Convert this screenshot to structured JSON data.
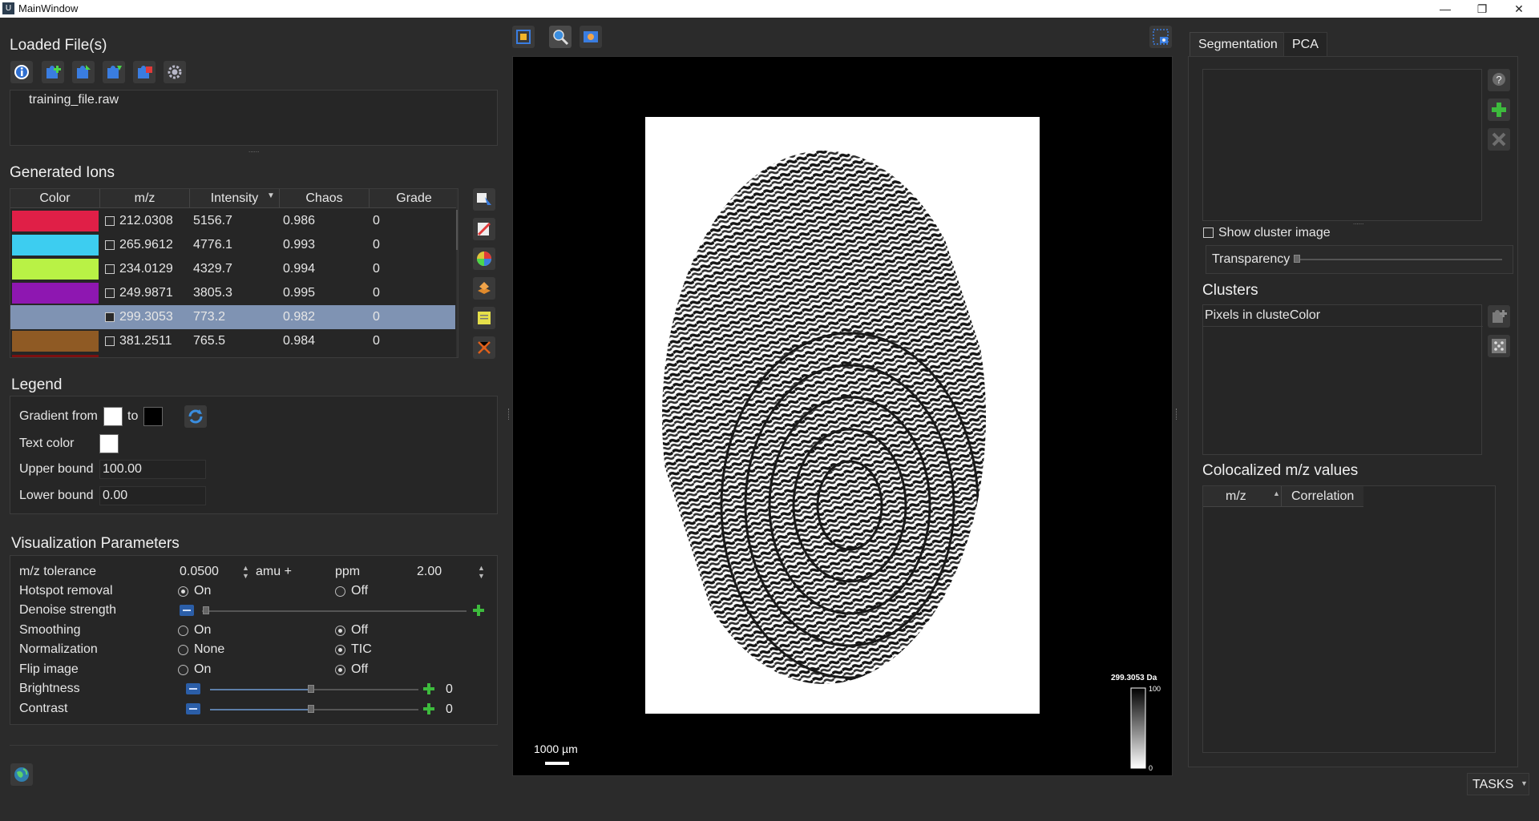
{
  "window": {
    "title": "MainWindow",
    "min": "—",
    "max": "❐",
    "close": "✕"
  },
  "loaded": {
    "title": "Loaded File(s)",
    "files": [
      "training_file.raw"
    ]
  },
  "ions": {
    "title": "Generated Ions",
    "headers": [
      "Color",
      "m/z",
      "Intensity",
      "Chaos",
      "Grade"
    ],
    "rows": [
      {
        "color": "#e01f47",
        "mz": "212.0308",
        "intensity": "5156.7",
        "chaos": "0.986",
        "grade": "0",
        "selected": false
      },
      {
        "color": "#3dcdf0",
        "mz": "265.9612",
        "intensity": "4776.1",
        "chaos": "0.993",
        "grade": "0",
        "selected": false
      },
      {
        "color": "#b9f245",
        "mz": "234.0129",
        "intensity": "4329.7",
        "chaos": "0.994",
        "grade": "0",
        "selected": false
      },
      {
        "color": "#8e17b1",
        "mz": "249.9871",
        "intensity": "3805.3",
        "chaos": "0.995",
        "grade": "0",
        "selected": false
      },
      {
        "color": "#7f93b3",
        "mz": "299.3053",
        "intensity": "773.2",
        "chaos": "0.982",
        "grade": "0",
        "selected": true
      },
      {
        "color": "#8f5a24",
        "mz": "381.2511",
        "intensity": "765.5",
        "chaos": "0.984",
        "grade": "0",
        "selected": false
      }
    ]
  },
  "legend": {
    "title": "Legend",
    "gradient_from": "Gradient from",
    "to": "to",
    "from_color": "#ffffff",
    "to_color": "#000000",
    "text_color_label": "Text color",
    "text_color": "#ffffff",
    "upper_label": "Upper bound",
    "upper_value": "100.00",
    "lower_label": "Lower bound",
    "lower_value": "0.00"
  },
  "vis": {
    "title": "Visualization Parameters",
    "mz_tol_label": "m/z tolerance",
    "mz_tol_value": "0.0500",
    "amu": "amu +",
    "ppm": "ppm",
    "ppm_value": "2.00",
    "hotspot_label": "Hotspot removal",
    "denoise_label": "Denoise strength",
    "smoothing_label": "Smoothing",
    "normalization_label": "Normalization",
    "flip_label": "Flip image",
    "brightness_label": "Brightness",
    "brightness_value": "0",
    "contrast_label": "Contrast",
    "contrast_value": "0",
    "on": "On",
    "off": "Off",
    "none": "None",
    "tic": "TIC"
  },
  "viewer": {
    "scale_label": "1000 µm",
    "colorbar_title": "299.3053 Da",
    "colorbar_max": "100",
    "colorbar_min": "0"
  },
  "right": {
    "tabs": [
      "Segmentation",
      "PCA"
    ],
    "show_cluster": "Show cluster image",
    "transparency": "Transparency",
    "clusters_title": "Clusters",
    "clusters_header": "Pixels in clusteColor",
    "colocalized_title": "Colocalized m/z values",
    "coloc_headers": [
      "m/z",
      "Correlation"
    ],
    "tasks": "TASKS"
  }
}
